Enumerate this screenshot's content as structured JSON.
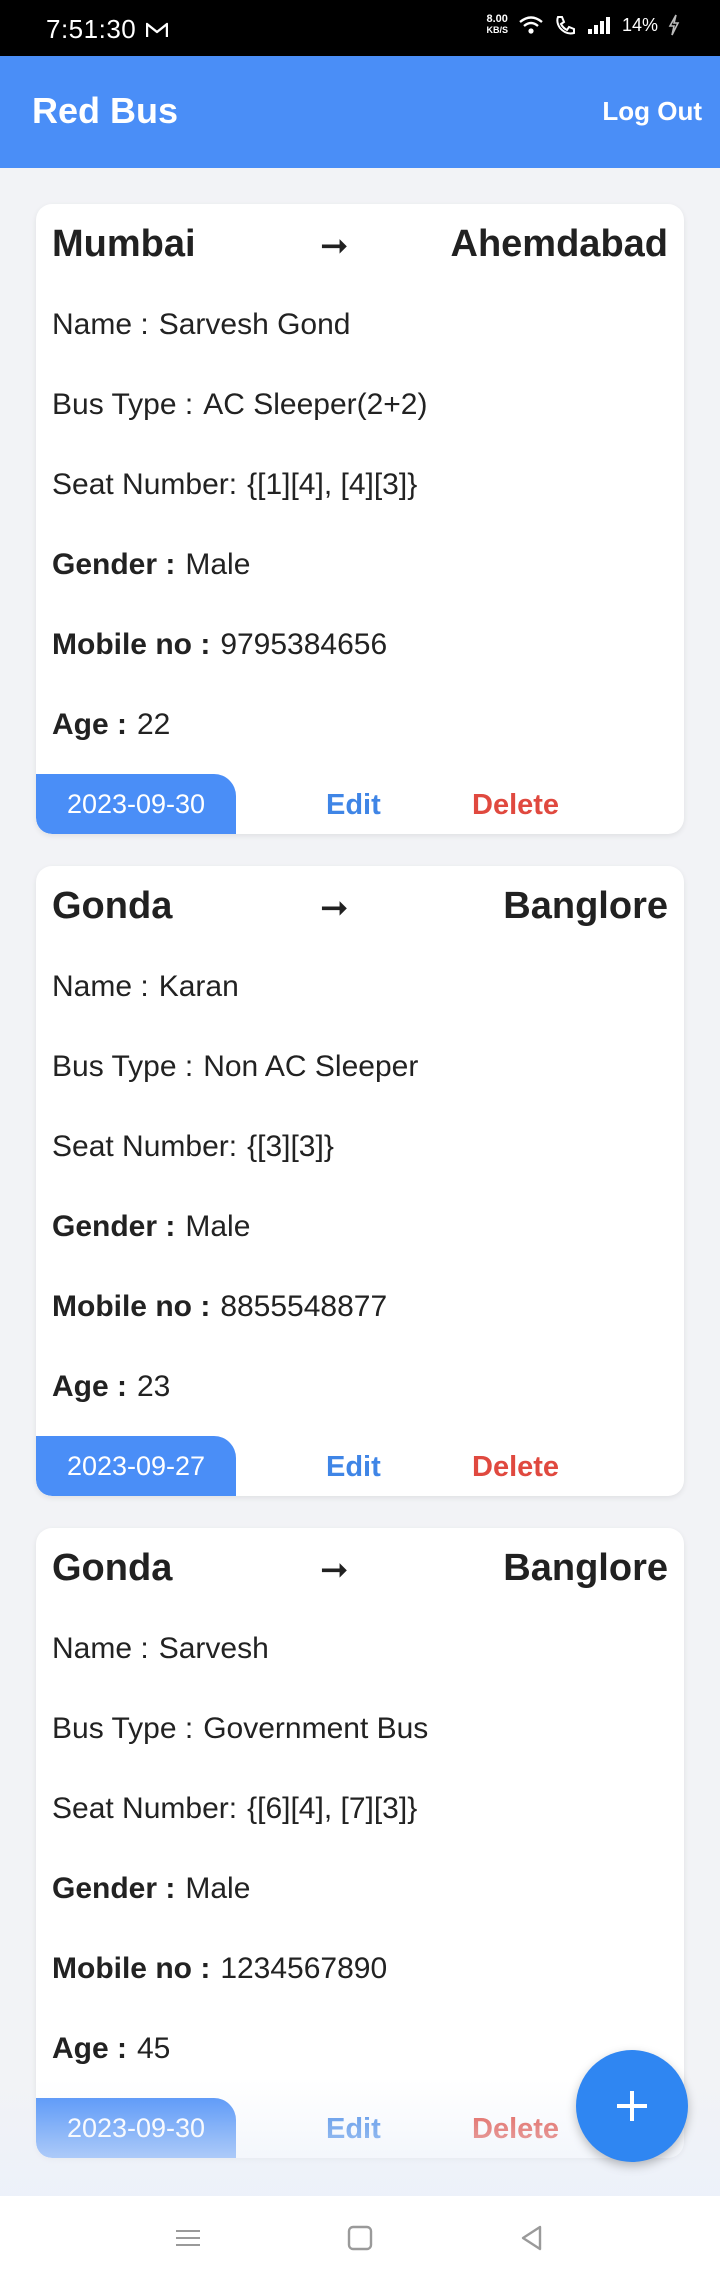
{
  "status_bar": {
    "time": "7:51:30",
    "speed_value": "8.00",
    "speed_unit": "KB/S",
    "battery": "14%",
    "icons": [
      "mail-icon",
      "wifi-icon",
      "call-icon",
      "signal-icon",
      "battery-charging-icon"
    ]
  },
  "app_bar": {
    "title": "Red Bus",
    "logout_label": "Log Out",
    "background_color": "#4a8ef7"
  },
  "labels": {
    "name": "Name :",
    "bus_type": "Bus Type :",
    "seat_number": "Seat Number:",
    "gender": "Gender :",
    "mobile": "Mobile no :",
    "age": "Age :",
    "arrow": "➞",
    "edit": "Edit",
    "delete": "Delete"
  },
  "bookings": [
    {
      "from": "Mumbai",
      "to": "Ahemdabad",
      "name": "Sarvesh Gond",
      "bus_type": "AC Sleeper(2+2)",
      "seat_number": "{[1][4], [4][3]}",
      "gender": "Male",
      "mobile": "9795384656",
      "age": "22",
      "date": "2023-09-30"
    },
    {
      "from": "Gonda",
      "to": "Banglore",
      "name": "Karan",
      "bus_type": "Non AC Sleeper",
      "seat_number": "{[3][3]}",
      "gender": "Male",
      "mobile": "8855548877",
      "age": "23",
      "date": "2023-09-27"
    },
    {
      "from": "Gonda",
      "to": "Banglore",
      "name": "Sarvesh",
      "bus_type": "Government Bus",
      "seat_number": "{[6][4], [7][3]}",
      "gender": "Male",
      "mobile": "1234567890",
      "age": "45",
      "date": "2023-09-30"
    }
  ],
  "fab": {
    "icon": "plus-icon",
    "color": "#2f86f2"
  },
  "colors": {
    "edit": "#3f85e6",
    "delete": "#e0493f",
    "date_chip": "#4a8ef7"
  },
  "nav_bar": {
    "icons": [
      "menu-icon",
      "home-square-icon",
      "back-triangle-icon"
    ]
  }
}
